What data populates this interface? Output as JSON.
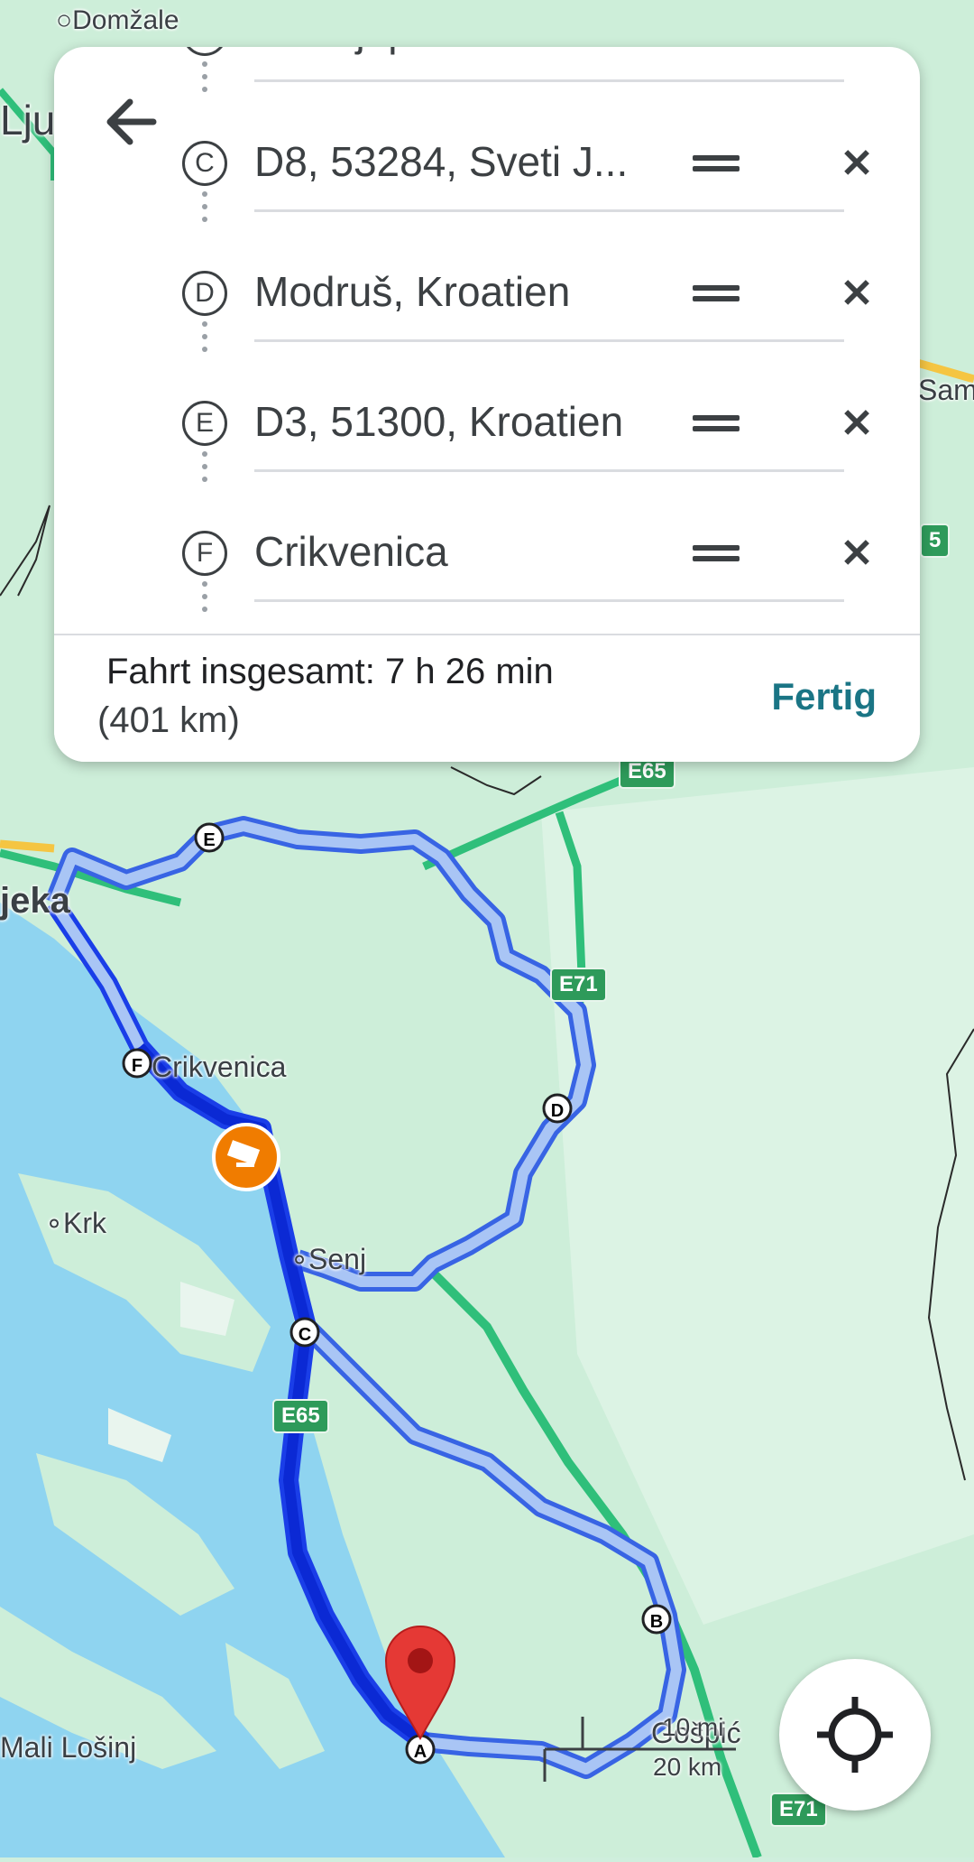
{
  "map": {
    "labels": {
      "domzale": "Domžale",
      "ljubljana": "Lju",
      "rijeka": "jeka",
      "crikvenica": "Crikvenica",
      "krk": "Krk",
      "senj": "Senj",
      "mali_losinj": "Mali Lošinj",
      "gospic": "Gošpić",
      "sam": "Sam"
    },
    "shields": {
      "e65_top": "E65",
      "e71_mid": "E71",
      "e65_mid": "E65",
      "e71_bottom": "E71",
      "right_5": "5"
    },
    "markers": {
      "a": "A",
      "b": "B",
      "c": "C",
      "d": "D",
      "e": "E",
      "f": "F"
    },
    "scale": {
      "imperial": "10 mi",
      "metric": "20 km"
    },
    "colors": {
      "route_primary": "#1a3ee8",
      "route_alt": "#a9c5f5",
      "highway": "#2fbf7a",
      "water": "#8fd4f0",
      "land": "#cdeed9",
      "pin": "#e53935",
      "camera": "#f07c00"
    }
  },
  "panel": {
    "waypoints": [
      {
        "letter": "B",
        "text": "Ul. Stjepana Radić..."
      },
      {
        "letter": "C",
        "text": "D8, 53284, Sveti J..."
      },
      {
        "letter": "D",
        "text": "Modruš, Kroatien"
      },
      {
        "letter": "E",
        "text": "D3, 51300, Kroatien"
      },
      {
        "letter": "F",
        "text": "Crikvenica"
      }
    ],
    "total_label": "Fahrt insgesamt: 7 h 26 min",
    "distance": "(401 km)",
    "done_button": "Fertig"
  }
}
